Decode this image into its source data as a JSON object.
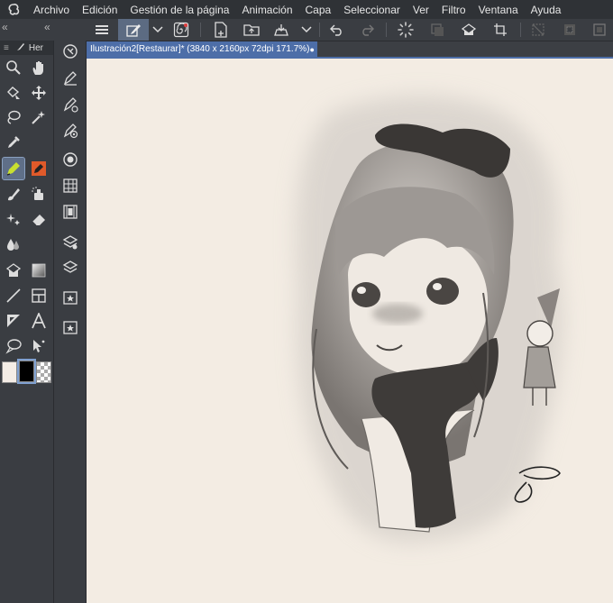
{
  "menu": {
    "items": [
      "Archivo",
      "Edición",
      "Gestión de la página",
      "Animación",
      "Capa",
      "Seleccionar",
      "Ver",
      "Filtro",
      "Ventana",
      "Ayuda"
    ]
  },
  "toolbar": {
    "icons": [
      "menu-icon",
      "edit-icon",
      "chevron-down-icon",
      "spiral-icon",
      "new-page-icon",
      "open-icon",
      "save-icon",
      "chevron-down-icon",
      "undo-icon",
      "redo-icon",
      "loading-icon",
      "stamp-icon",
      "fill-icon",
      "crop-icon",
      "deselect-icon",
      "invert-icon",
      "frame-icon"
    ]
  },
  "panel": {
    "tab_label": "Her",
    "collapse_left": "«",
    "collapse_right": "«",
    "menu_glyph": "≡"
  },
  "colors": {
    "main": "#f4ede6",
    "sub": "#000000",
    "accent": "#4d6ea8",
    "canvas": "#f3ece3"
  },
  "document": {
    "tab_title": "Ilustración2[Restaurar]* (3840 x 2160px 72dpi 171.7%)",
    "tab_dot": "●"
  },
  "artwork": {
    "signature": "Jo"
  }
}
